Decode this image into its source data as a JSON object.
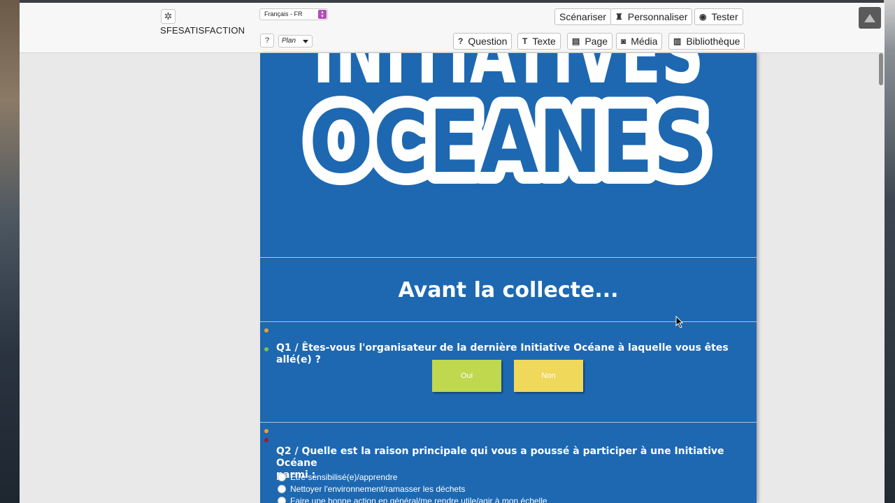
{
  "app": {
    "brand": "SFESATISFACTION",
    "language": "Français - FR",
    "help_label": "?",
    "plan_label": "Plan"
  },
  "toolbar_top": {
    "scenario_label": "Scénariser",
    "customize_label": "Personnaliser",
    "test_label": "Tester"
  },
  "toolbar_insert": {
    "question_label": "Question",
    "text_label": "Texte",
    "page_label": "Page",
    "media_label": "Média",
    "library_label": "Bibliothèque"
  },
  "survey": {
    "logo_line1": "INITIATIVES",
    "logo_line2": "OCEANES",
    "heading": "Avant la collecte...",
    "q1": {
      "title": "Q1 / Êtes-vous l'organisateur de la dernière Initiative Océane à laquelle vous êtes allé(e) ?",
      "answers": [
        {
          "label": "Oui",
          "color": "#bfd84d"
        },
        {
          "label": "Non",
          "color": "#efd85a"
        }
      ]
    },
    "q2": {
      "title_line1": "Q2 / Quelle est la raison principale qui vous a poussé à participer à une Initiative Océane",
      "title_line2": "parmi :",
      "options": [
        "Être sensibilisé(e)/apprendre",
        "Nettoyer l'environnement/ramasser les déchets",
        "Faire une bonne action en général/me rendre utile/agir à mon échelle"
      ]
    }
  },
  "colors": {
    "survey_bg": "#1d68b1",
    "dot_orange": "#f0a020",
    "dot_green": "#7cc242",
    "dot_red": "#b01818"
  }
}
